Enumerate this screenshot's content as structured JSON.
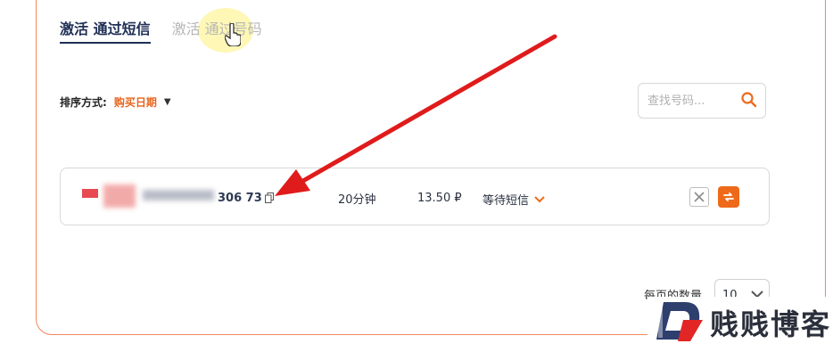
{
  "tabs": [
    {
      "label": "激活 通过短信",
      "active": true
    },
    {
      "label": "激活 通过号码",
      "active": false
    }
  ],
  "sort": {
    "label": "排序方式:",
    "value": "购买日期"
  },
  "search": {
    "placeholder": "查找号码..."
  },
  "row": {
    "phone_suffix": "306 73",
    "duration": "20分钟",
    "price": "13.50 ₽",
    "status": "等待短信"
  },
  "pagination": {
    "label": "每页的数量",
    "value": "10"
  },
  "watermark": {
    "text": "贱贱博客"
  },
  "colors": {
    "accent": "#ee6a1a",
    "arrow": "#e01b1b",
    "card_border": "#ef8a5b",
    "tab_active": "#1f2f55"
  }
}
